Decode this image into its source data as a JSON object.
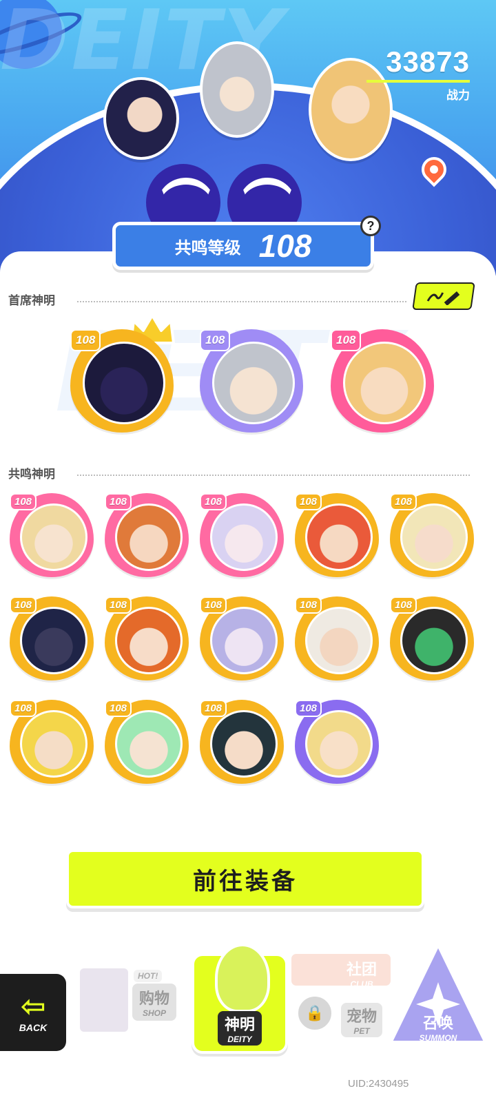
{
  "hero": {
    "bg_word": "DEITY",
    "power_value": "33873",
    "power_label": "战力"
  },
  "level": {
    "label": "共鸣等级",
    "value": "108",
    "help": "?"
  },
  "sections": {
    "chief": "首席神明",
    "resonance": "共鸣神明"
  },
  "watermark": "DEITY",
  "chief_deities": [
    {
      "level": "108",
      "frame": "#f7b51f",
      "face": "#2a2358",
      "hair": "#1c1a3c",
      "crowned": true
    },
    {
      "level": "108",
      "frame": "#9f8cf5",
      "face": "#f5e3d2",
      "hair": "#c0c4cc"
    },
    {
      "level": "108",
      "frame": "#ff5c9a",
      "face": "#f8dcc0",
      "hair": "#f2c77a"
    }
  ],
  "resonance_deities": [
    {
      "level": "108",
      "frame": "#ff6aa2",
      "face": "#f7e3cf",
      "hair": "#f0d9a0"
    },
    {
      "level": "108",
      "frame": "#ff6aa2",
      "face": "#f6d7c0",
      "hair": "#e07a3a"
    },
    {
      "level": "108",
      "frame": "#ff6aa2",
      "face": "#f6e8ee",
      "hair": "#d9d2f2"
    },
    {
      "level": "108",
      "frame": "#f7b51f",
      "face": "#f6d9c2",
      "hair": "#ea5a3a"
    },
    {
      "level": "108",
      "frame": "#f7b51f",
      "face": "#f6dccb",
      "hair": "#f2e6b8"
    },
    {
      "level": "108",
      "frame": "#f7b51f",
      "face": "#3a3a5c",
      "hair": "#1f2447"
    },
    {
      "level": "108",
      "frame": "#f7b51f",
      "face": "#f7dcc8",
      "hair": "#e46a2a"
    },
    {
      "level": "108",
      "frame": "#f7b51f",
      "face": "#eee4f3",
      "hair": "#b7b2e6"
    },
    {
      "level": "108",
      "frame": "#f7b51f",
      "face": "#f3d6c0",
      "hair": "#efeae2"
    },
    {
      "level": "108",
      "frame": "#f7b51f",
      "face": "#3fb36a",
      "hair": "#2a2a2a"
    },
    {
      "level": "108",
      "frame": "#f7b51f",
      "face": "#f5ddc6",
      "hair": "#f4d64a"
    },
    {
      "level": "108",
      "frame": "#f7b51f",
      "face": "#f5e3d2",
      "hair": "#9ee8b4"
    },
    {
      "level": "108",
      "frame": "#f7b51f",
      "face": "#f5dcc8",
      "hair": "#23343c"
    },
    {
      "level": "108",
      "frame": "#8a6cf0",
      "face": "#f8e0c8",
      "hair": "#f2da8a"
    }
  ],
  "cta": {
    "label": "前往装备"
  },
  "nav": {
    "back": "BACK",
    "shop_cn": "购物",
    "shop_en": "SHOP",
    "hot": "HOT!",
    "deity_cn": "神明",
    "deity_en": "DEITY",
    "club_cn": "社团",
    "club_en": "CLUB",
    "pet_cn": "宠物",
    "pet_en": "PET",
    "summon_cn": "召唤",
    "summon_en": "SUMMON"
  },
  "uid": "UID:2430495",
  "colors": {
    "accent": "#e3ff1e",
    "hero_blue": "#3b7fe6"
  }
}
